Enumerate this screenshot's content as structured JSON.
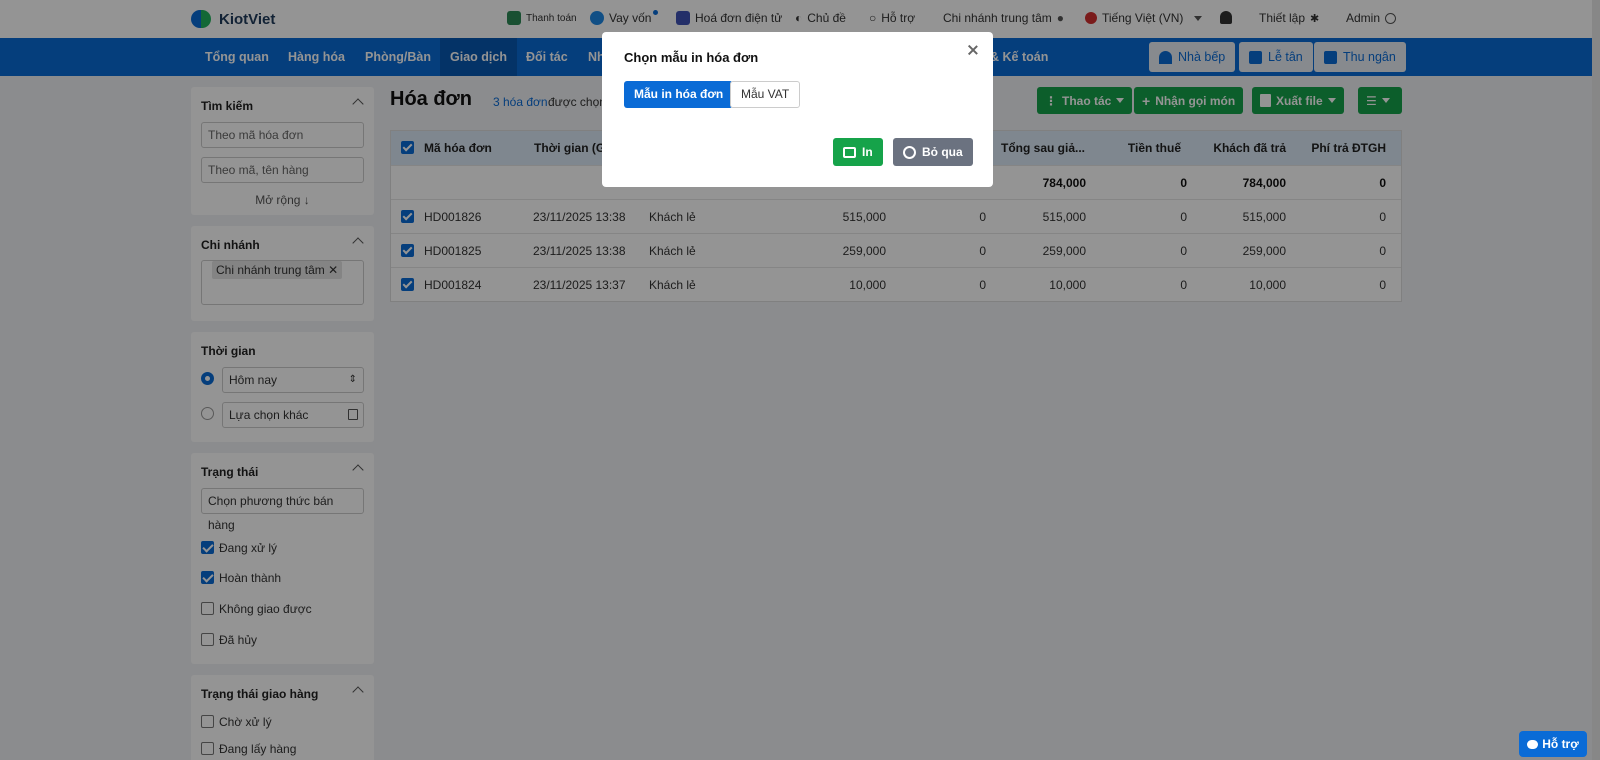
{
  "app": {
    "brand": "KiotViet"
  },
  "topbar": {
    "items": [
      "Thanh toán",
      "Vay vốn",
      "Hoá đơn điện tử",
      "Chủ đề",
      "Hỗ trợ",
      "Chi nhánh trung tâm",
      "Tiếng Việt (VN)",
      "Thiết lập",
      "Admin"
    ]
  },
  "nav": {
    "items": [
      "Tổng quan",
      "Hàng hóa",
      "Phòng/Bàn",
      "Giao dịch",
      "Đối tác",
      "Nh",
      "& Kế toán"
    ],
    "active": "Giao dịch",
    "right_buttons": [
      "Nhà bếp",
      "Lễ tân",
      "Thu ngân"
    ]
  },
  "sidebar": {
    "search": {
      "title": "Tìm kiếm",
      "placeholder_code": "Theo mã hóa đơn",
      "placeholder_item": "Theo mã, tên hàng",
      "expand": "Mở rộng"
    },
    "branch": {
      "title": "Chi nhánh",
      "chip": "Chi nhánh trung tâm"
    },
    "time": {
      "title": "Thời gian",
      "option_today": "Hôm nay",
      "option_other": "Lựa chọn khác"
    },
    "status": {
      "title": "Trạng thái",
      "placeholder": "Chọn phương thức bán hàng",
      "options": [
        {
          "label": "Đang xử lý",
          "checked": true
        },
        {
          "label": "Hoàn thành",
          "checked": true
        },
        {
          "label": "Không giao được",
          "checked": false
        },
        {
          "label": "Đã hủy",
          "checked": false
        }
      ]
    },
    "delivery": {
      "title": "Trạng thái giao hàng",
      "options": [
        {
          "label": "Chờ xử lý",
          "checked": false
        },
        {
          "label": "Đang lấy hàng",
          "checked": false
        }
      ]
    }
  },
  "main": {
    "title": "Hóa đơn",
    "count_link": "3 hóa đơn",
    "count_text": "được chọn",
    "actions": [
      "Thao tác",
      "Nhận gọi món",
      "Xuất file"
    ]
  },
  "table": {
    "headers": [
      "Mã hóa đơn",
      "Thời gian (Gi",
      "Tổng sau giả...",
      "Tiền thuế",
      "Khách đã trả",
      "Phí trả ĐTGH"
    ],
    "summary": {
      "total_after": "784,000",
      "tax": "0",
      "paid": "784,000",
      "fee": "0"
    },
    "rows": [
      {
        "code": "HD001826",
        "time": "23/11/2025 13:38",
        "customer": "Khách lẻ",
        "total": "515,000",
        "discount": "0",
        "total_after": "515,000",
        "tax": "0",
        "paid": "515,000",
        "fee": "0"
      },
      {
        "code": "HD001825",
        "time": "23/11/2025 13:38",
        "customer": "Khách lẻ",
        "total": "259,000",
        "discount": "0",
        "total_after": "259,000",
        "tax": "0",
        "paid": "259,000",
        "fee": "0"
      },
      {
        "code": "HD001824",
        "time": "23/11/2025 13:37",
        "customer": "Khách lẻ",
        "total": "10,000",
        "discount": "0",
        "total_after": "10,000",
        "tax": "0",
        "paid": "10,000",
        "fee": "0"
      }
    ]
  },
  "modal": {
    "title": "Chọn mẫu in hóa đơn",
    "tab_primary": "Mẫu in hóa đơn",
    "tab_secondary": "Mẫu VAT",
    "print_button": "In",
    "skip_button": "Bỏ qua"
  },
  "help_button": "Hỗ trợ"
}
